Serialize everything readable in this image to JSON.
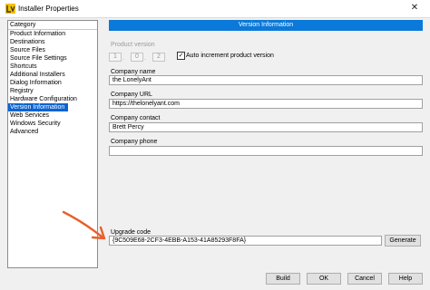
{
  "window": {
    "title": "Installer Properties",
    "close_glyph": "✕",
    "app_icon": "labview-icon"
  },
  "sidebar": {
    "header": "Category",
    "items": [
      {
        "label": "Product Information"
      },
      {
        "label": "Destinations"
      },
      {
        "label": "Source Files"
      },
      {
        "label": "Source File Settings"
      },
      {
        "label": "Shortcuts"
      },
      {
        "label": "Additional Installers"
      },
      {
        "label": "Dialog Information"
      },
      {
        "label": "Registry"
      },
      {
        "label": "Hardware Configuration"
      },
      {
        "label": "Version Information",
        "selected": true
      },
      {
        "label": "Web Services"
      },
      {
        "label": "Windows Security"
      },
      {
        "label": "Advanced"
      }
    ]
  },
  "main": {
    "header": "Version Information",
    "product_version": {
      "label": "Product version",
      "parts": [
        "1",
        "0",
        "2"
      ],
      "separator": "."
    },
    "auto_increment": {
      "label": "Auto increment product version",
      "checked": true,
      "check_glyph": "✓"
    },
    "company_name": {
      "label": "Company name",
      "value": "the LonelyAnt"
    },
    "company_url": {
      "label": "Company URL",
      "value": "https://thelonelyant.com"
    },
    "company_contact": {
      "label": "Company contact",
      "value": "Brett Percy"
    },
    "company_phone": {
      "label": "Company phone",
      "value": ""
    },
    "upgrade_code": {
      "label": "Upgrade code",
      "value": "{9C509E68-2CF3-4EBB-A153-41A85293F8FA}"
    },
    "generate_label": "Generate"
  },
  "footer": {
    "build_label": "Build",
    "ok_label": "OK",
    "cancel_label": "Cancel",
    "help_label": "Help"
  },
  "colors": {
    "accent": "#0a79d9",
    "selection": "#0a64d2",
    "annotation_arrow": "#e8602c"
  }
}
